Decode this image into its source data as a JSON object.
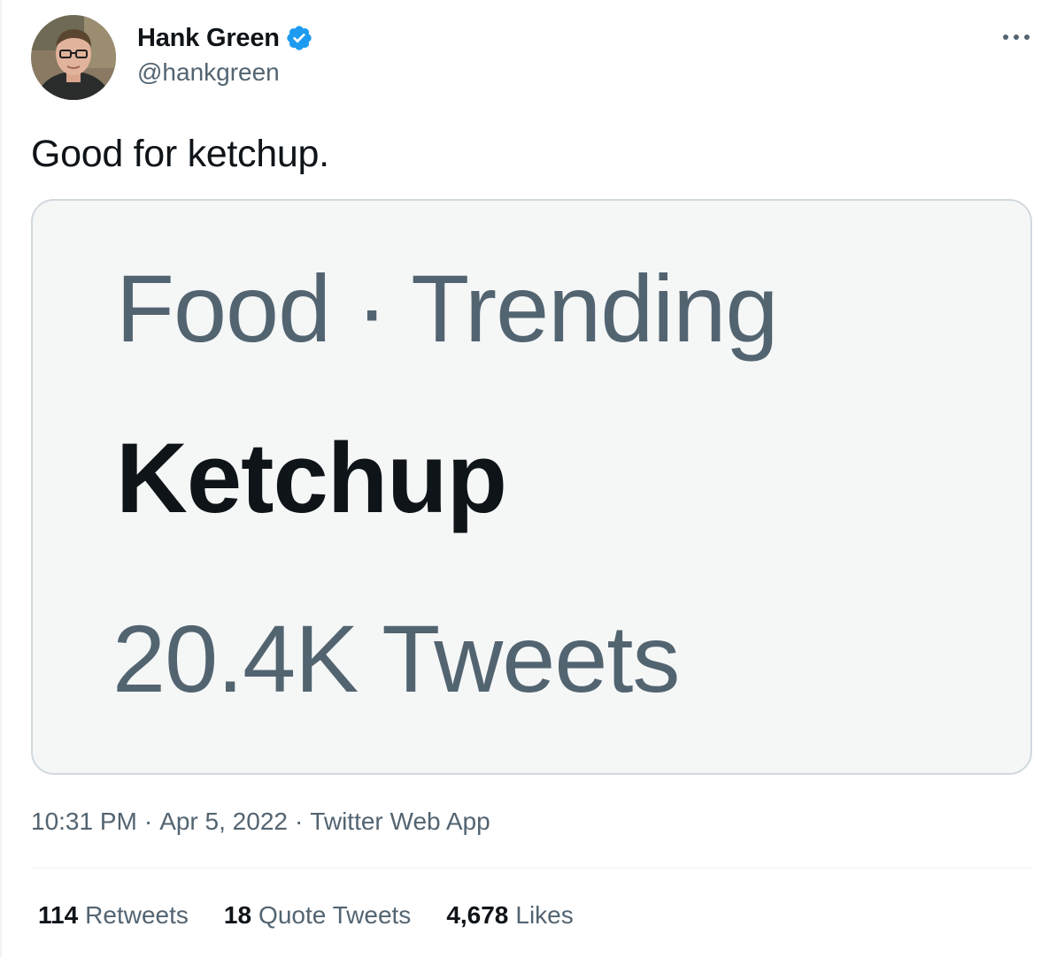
{
  "author": {
    "name": "Hank Green",
    "handle": "@hankgreen",
    "verified_icon": "verified-badge-icon",
    "verified_color": "#1d9bf0"
  },
  "tweet": {
    "text": "Good for ketchup."
  },
  "media": {
    "trend_context": "Food · Trending",
    "trend_name": "Ketchup",
    "trend_count": "20.4K Tweets"
  },
  "meta": {
    "time": "10:31 PM",
    "separator": "·",
    "date": "Apr 5, 2022",
    "source": "Twitter Web App"
  },
  "stats": {
    "retweets_count": "114",
    "retweets_label": "Retweets",
    "quotes_count": "18",
    "quotes_label": "Quote Tweets",
    "likes_count": "4,678",
    "likes_label": "Likes"
  },
  "icons": {
    "more": "more-options-icon"
  },
  "colors": {
    "text_primary": "#0f1419",
    "text_secondary": "#536471",
    "border": "#cfd9de",
    "card_background": "#f5f7f7"
  }
}
